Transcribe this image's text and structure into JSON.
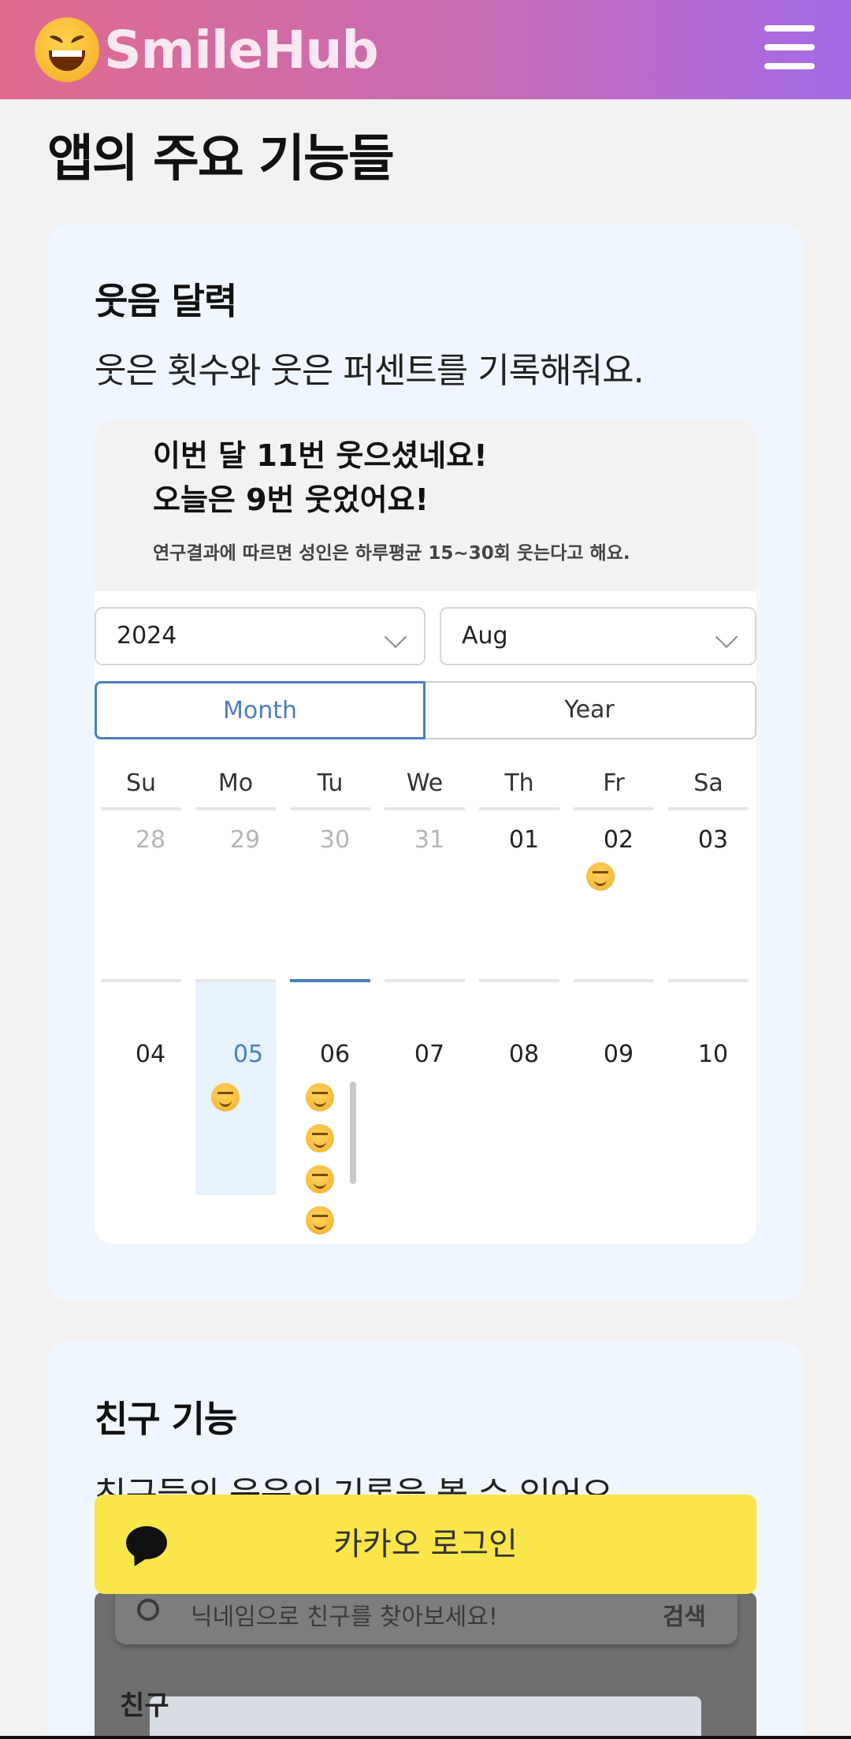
{
  "header": {
    "logo_text": "SmileHub",
    "logo_icon": "grinning-squinting-face-icon",
    "menu_icon": "hamburger-menu-icon"
  },
  "page": {
    "section_title": "앱의 주요 기능들"
  },
  "calendar_card": {
    "title": "웃음 달력",
    "description": "웃은 횟수와 웃은 퍼센트를 기록해줘요.",
    "stats_line1": "이번 달 11번 웃으셨네요!",
    "stats_line2": "오늘은 9번 웃었어요!",
    "stats_note": "연구결과에 따르면 성인은 하루평균 15~30회 웃는다고 해요.",
    "year_select": "2024",
    "month_select": "Aug",
    "view_toggle": {
      "month": "Month",
      "year": "Year",
      "selected": "Month"
    },
    "weekdays": [
      "Su",
      "Mo",
      "Tu",
      "We",
      "Th",
      "Fr",
      "Sa"
    ],
    "week1": [
      "28",
      "29",
      "30",
      "31",
      "01",
      "02",
      "03"
    ],
    "week2": [
      "04",
      "05",
      "06",
      "07",
      "08",
      "09",
      "10"
    ],
    "today": "05"
  },
  "friend_card": {
    "title": "친구 기능",
    "description": "친구들의 웃음의 기록을 볼 수 있어요",
    "search_placeholder": "닉네임으로 친구를 찾아보세요!",
    "search_button": "검색",
    "friends_label": "친구"
  },
  "kakao_login": {
    "label": "카카오 로그인",
    "icon": "speech-bubble-icon",
    "color": "#fae54a"
  },
  "colors": {
    "accent": "#4a7ec2",
    "header_start": "#e06b8e",
    "header_end": "#a56ae8",
    "card_bg": "#eff6fe"
  }
}
